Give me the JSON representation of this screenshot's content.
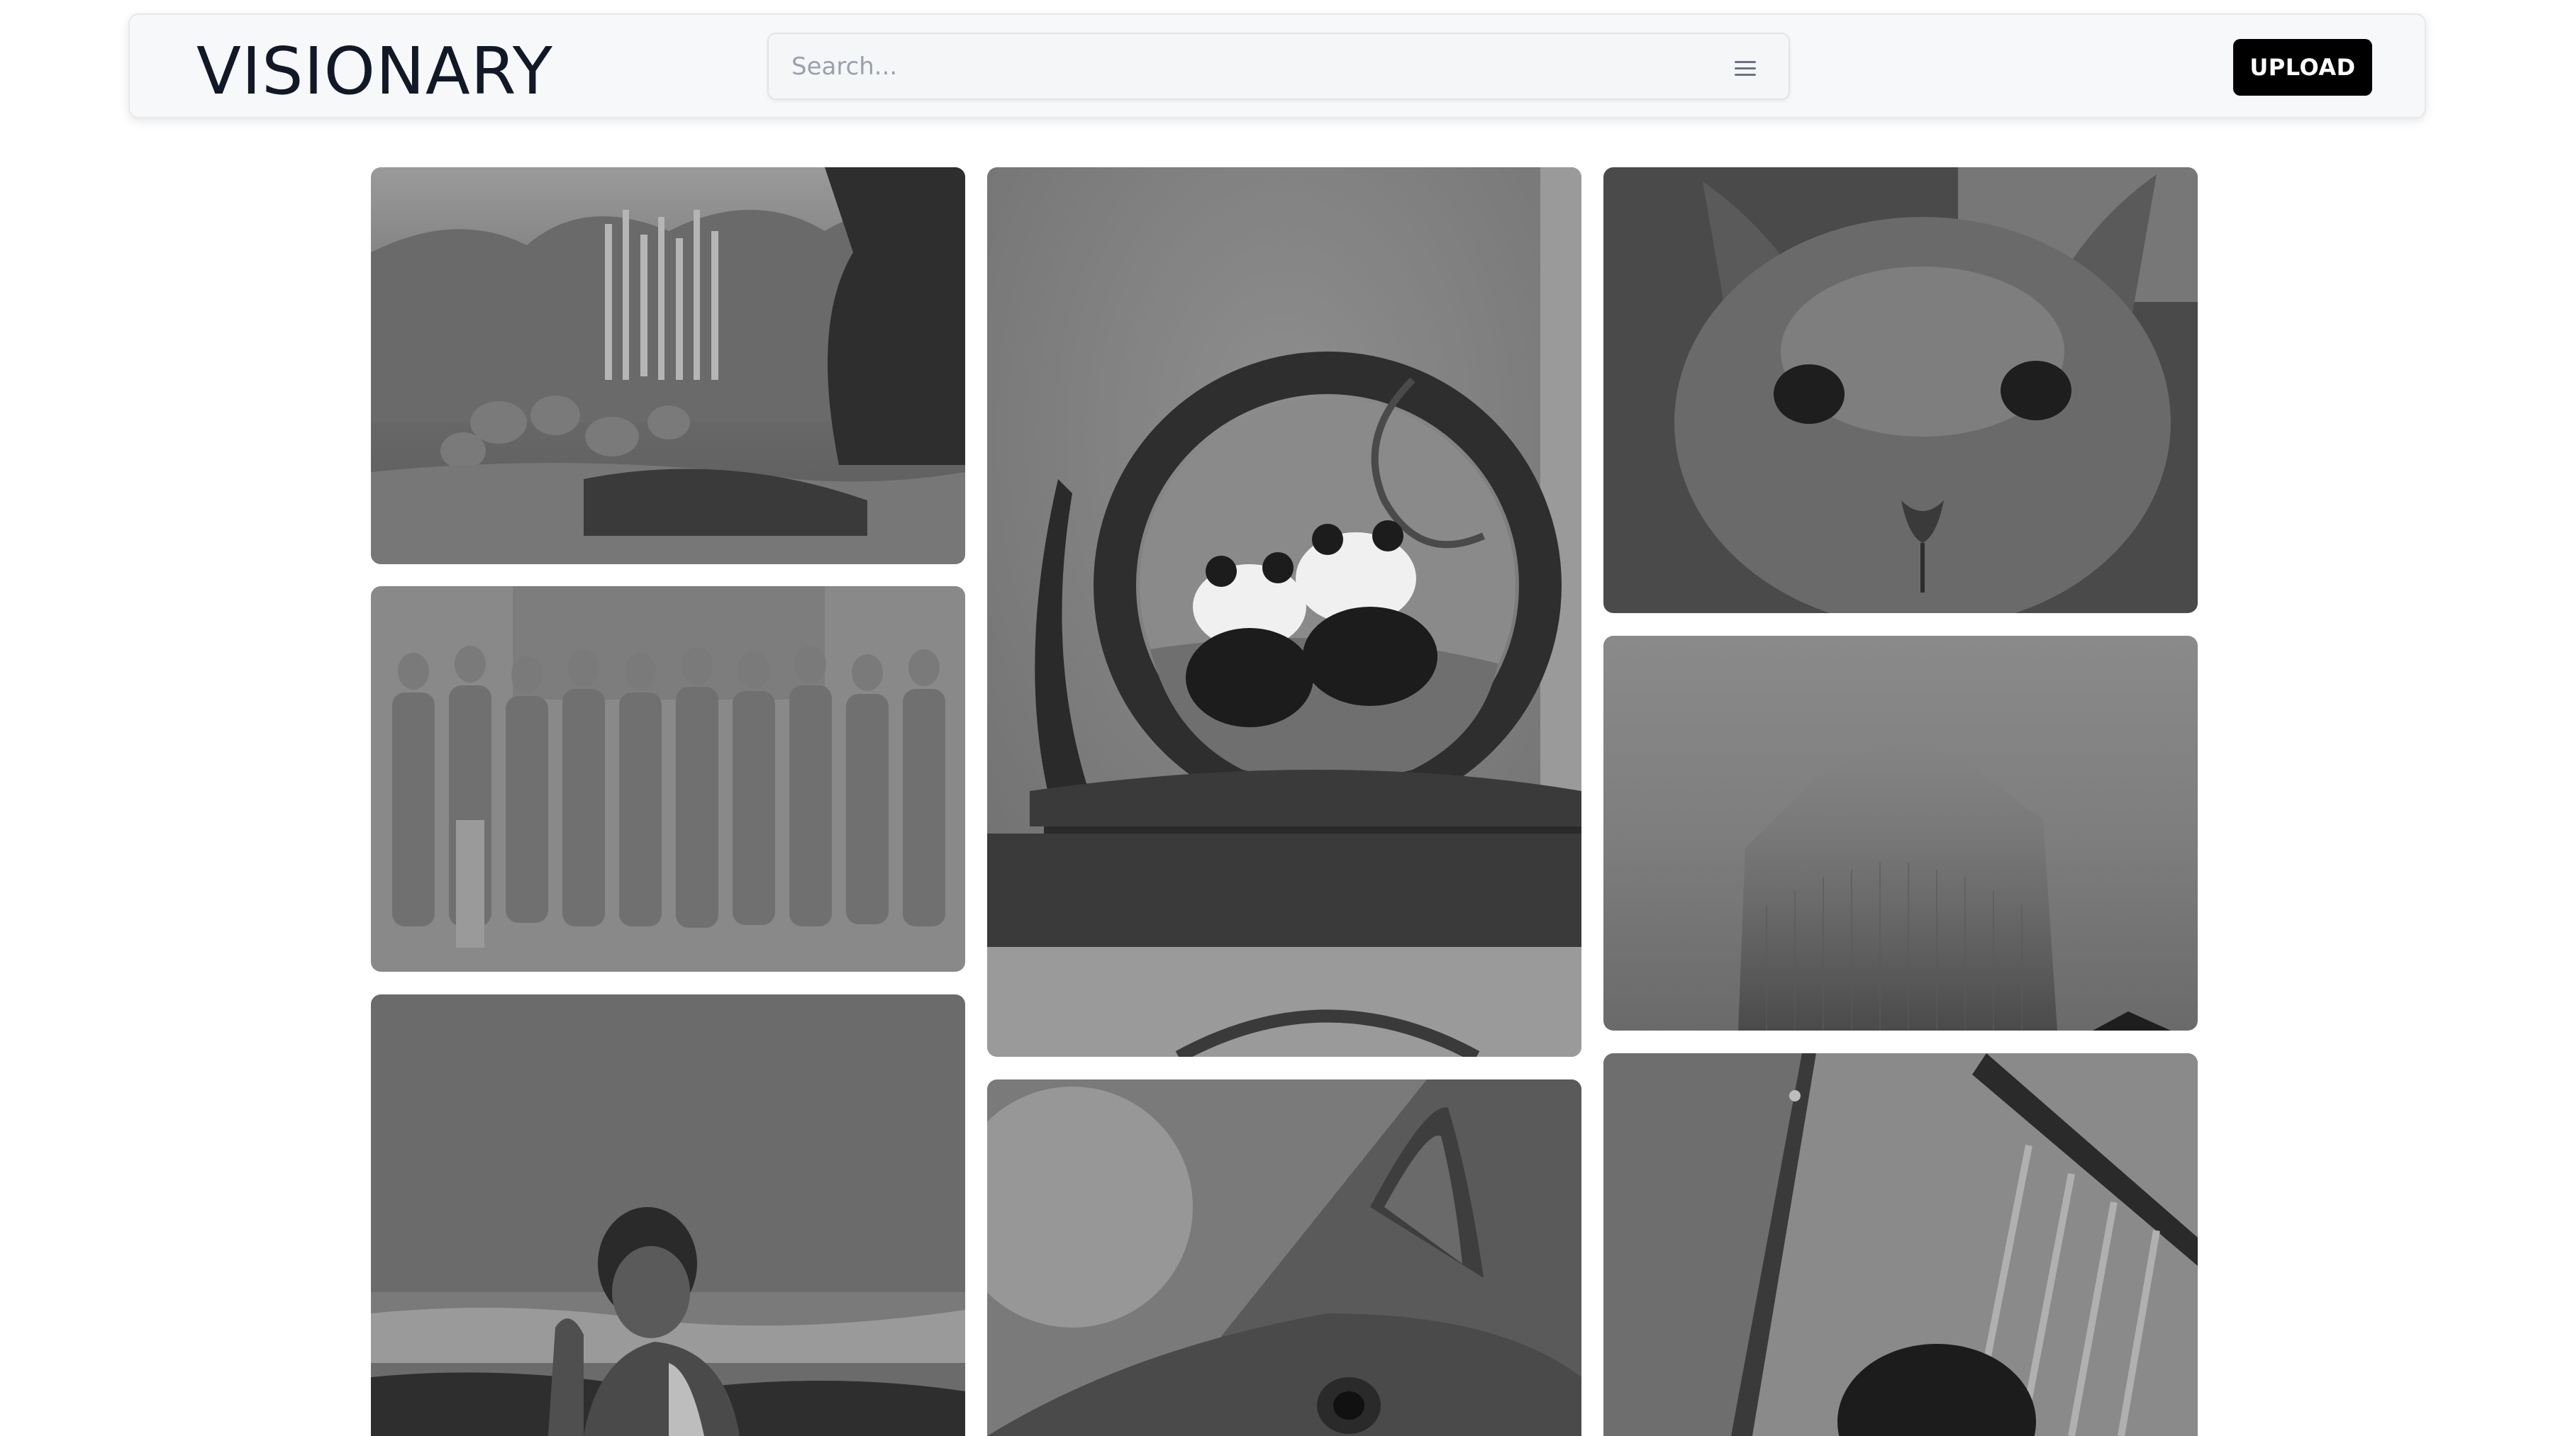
{
  "header": {
    "logo": "VISIONARY",
    "search_placeholder": "Search...",
    "upload_label": "UPLOAD"
  },
  "gallery": {
    "photos": [
      {
        "subject": "cactus-garden"
      },
      {
        "subject": "group-photo"
      },
      {
        "subject": "person-at-beach"
      },
      {
        "subject": "panda-embroidery-screen"
      },
      {
        "subject": "cat-closeup-ear"
      },
      {
        "subject": "cat-face-closeup"
      },
      {
        "subject": "building-in-fog"
      },
      {
        "subject": "person-by-window"
      }
    ]
  },
  "colors": {
    "button_bg": "#000000",
    "logo_text": "#111827",
    "photo_tone": "grayscale"
  }
}
